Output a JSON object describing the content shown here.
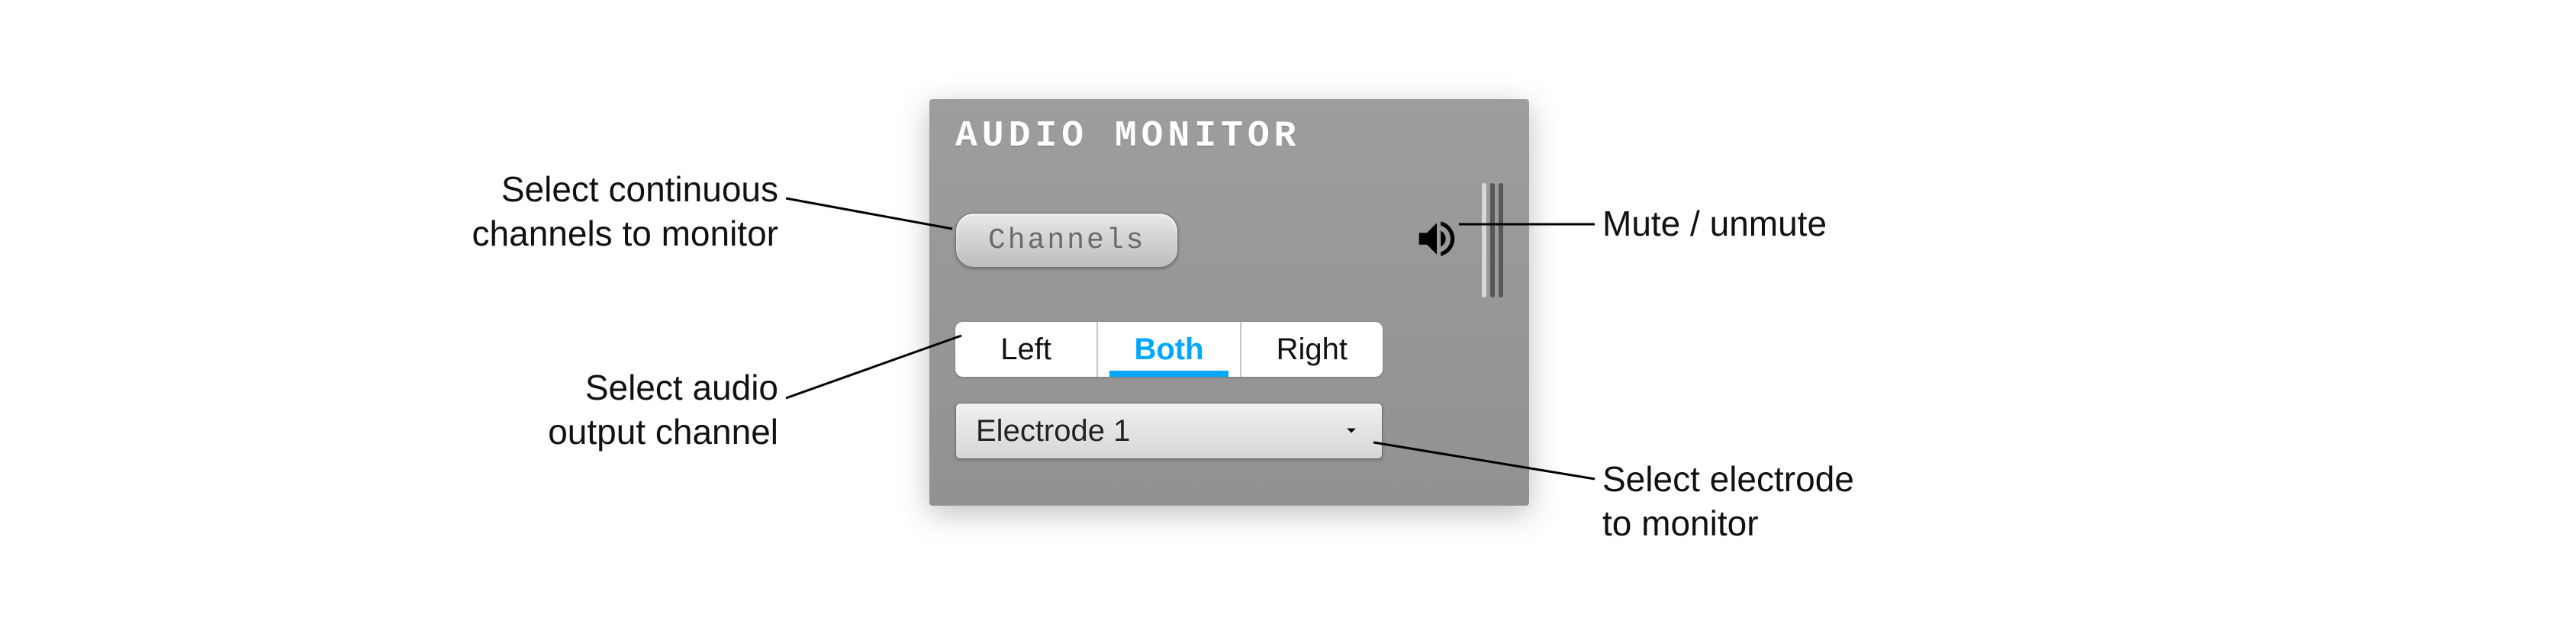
{
  "panel": {
    "title": "AUDIO MONITOR",
    "channels_btn": "Channels",
    "output_segments": {
      "left": "Left",
      "both": "Both",
      "right": "Right",
      "active": "both"
    },
    "electrode_select": {
      "value": "Electrode 1"
    }
  },
  "annotations": {
    "channels": "Select continuous\nchannels to monitor",
    "output": "Select audio\noutput channel",
    "mute": "Mute / unmute",
    "electrode": "Select electrode\nto monitor"
  }
}
